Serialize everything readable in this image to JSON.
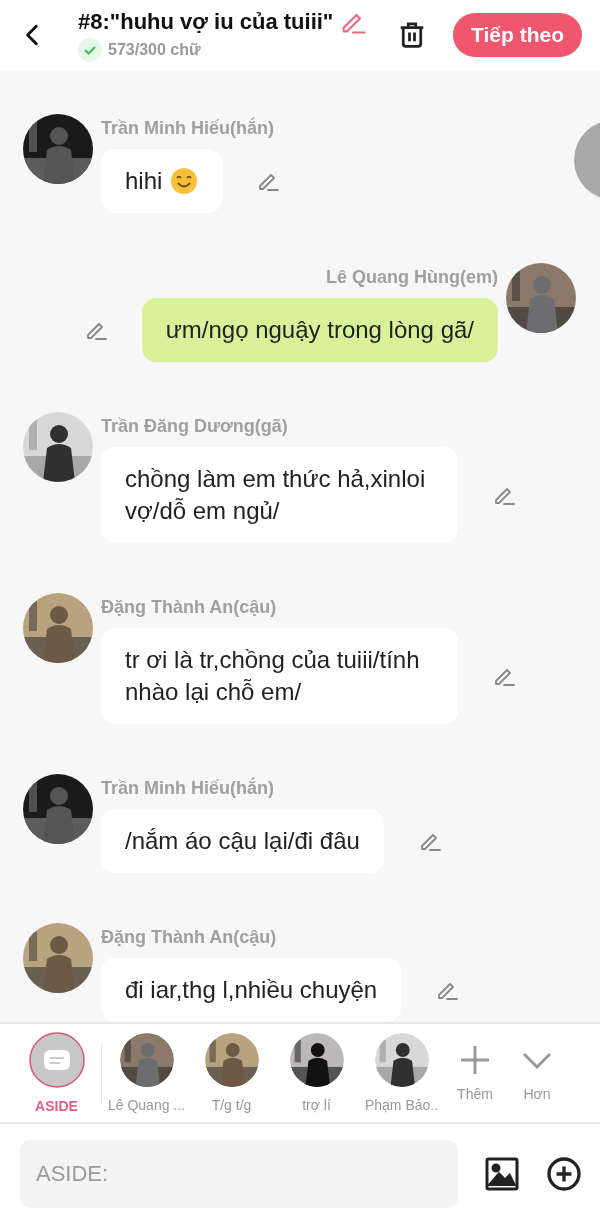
{
  "header": {
    "title": "#8:\"huhu vợ iu của tuiii\"",
    "count": "573/300 chữ",
    "count_ok": true,
    "next_button": "Tiếp theo"
  },
  "messages": [
    {
      "kind": "received",
      "name": "Trần Minh Hiếu(hắn)",
      "text": "hihi",
      "emoji": true
    },
    {
      "kind": "sent",
      "name": "Lê Quang Hùng(em)",
      "text": "ưm/ngọ nguậy trong lòng gã/",
      "emoji": false
    },
    {
      "kind": "received",
      "name": "Trần Đăng Dương(gã)",
      "text": "chồng làm em thức hả,xinloi vợ/dỗ em ngủ/",
      "emoji": false
    },
    {
      "kind": "received",
      "name": "Đặng Thành An(cậu)",
      "text": "tr ơi là tr,chồng của tuiii/tính nhào lại chỗ em/",
      "emoji": false
    },
    {
      "kind": "received",
      "name": "Trần Minh Hiếu(hắn)",
      "text": "/nắm áo cậu lại/đi đâu",
      "emoji": false
    },
    {
      "kind": "received",
      "name": "Đặng Thành An(cậu)",
      "text": "đi iar,thg l,nhiều chuyện",
      "emoji": false
    }
  ],
  "characters": [
    {
      "kind": "aside",
      "label": "ASIDE",
      "selected": true
    },
    {
      "kind": "character",
      "label": "Lê Quang ...",
      "selected": false
    },
    {
      "kind": "character",
      "label": "T/g t/g",
      "selected": false
    },
    {
      "kind": "character",
      "label": "trợ lí",
      "selected": false
    },
    {
      "kind": "character",
      "label": "Phạm Bảo..",
      "selected": false
    }
  ],
  "more_actions": [
    {
      "kind": "add",
      "label": "Thêm"
    },
    {
      "kind": "expand",
      "label": "Hơn"
    }
  ],
  "input": {
    "placeholder": "ASIDE:"
  }
}
